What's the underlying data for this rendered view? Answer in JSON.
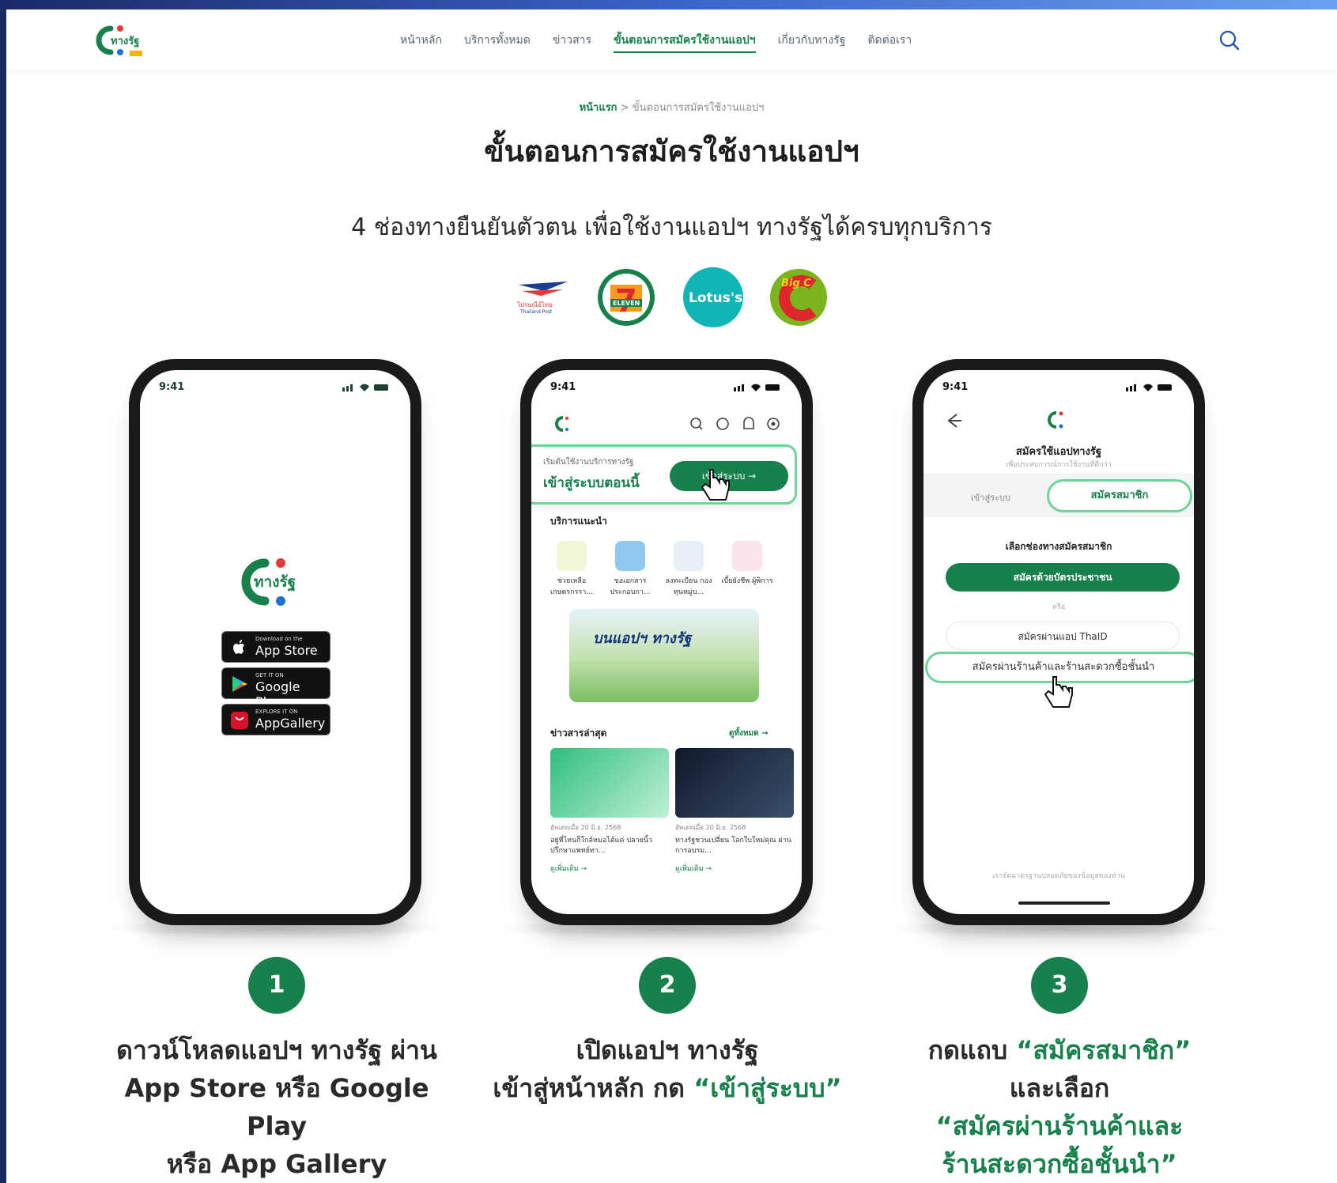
{
  "header": {
    "nav": [
      "หน้าหลัก",
      "บริการทั้งหมด",
      "ข่าวสาร",
      "ขั้นตอนการสมัครใช้งานแอปฯ",
      "เกี่ยวกับทางรัฐ",
      "ติดต่อเรา"
    ],
    "active_index": 3
  },
  "breadcrumb": {
    "home": "หน้าแรก",
    "sep": " > ",
    "current": "ขั้นตอนการสมัครใช้งานแอปฯ"
  },
  "title": "ขั้นตอนการสมัครใช้งานแอปฯ",
  "subtitle": "4 ช่องทางยืนยันตัวตน เพื่อใช้งานแอปฯ ทางรัฐได้ครบทุกบริการ",
  "partners": {
    "lotus": "Lotus's",
    "bigc": "Big C",
    "seven": "ELEVEN"
  },
  "phone1": {
    "time": "9:41",
    "app_name": "ทางรัฐ",
    "stores": [
      {
        "small": "Download on the",
        "big": "App Store"
      },
      {
        "small": "GET IT ON",
        "big": "Google Play"
      },
      {
        "small": "EXPLORE IT ON",
        "big": "AppGallery"
      }
    ]
  },
  "phone2": {
    "time": "9:41",
    "card_line1": "เริ่มต้นใช้งานบริการทางรัฐ",
    "card_line2": "เข้าสู่ระบบตอนนี้",
    "login_btn": "เข้าสู่ระบบ →",
    "recommended": "บริการแนะนำ",
    "services": [
      "ช่วยเหลือ เกษตรกรรา...",
      "ขอเอกสาร ประกอบกา...",
      "ลงทะเบียน กองทุนหมู่บ...",
      "เบี้ยยังชีพ ผู้พิการ"
    ],
    "banner": "บนแอปฯ ทางรัฐ",
    "news_label": "ข่าวสารล่าสุด",
    "see_all": "ดูทั้งหมด →",
    "news": [
      {
        "date": "อัพเดทเมื่อ 20 มิ.ย. 2568",
        "title": "อยู่ที่ไหนก็ใกล้หมอได้แค่ ปลายนิ้ว ปรึกษาแพทย์ทา...",
        "more": "ดูเพิ่มเติม →"
      },
      {
        "date": "อัพเดทเมื่อ 20 มิ.ย. 2568",
        "title": "ทางรัฐชวนเปลี่ยน โลกใบใหม่คุณ ผ่านการอบรม...",
        "more": "ดูเพิ่มเติม →"
      }
    ]
  },
  "phone3": {
    "time": "9:41",
    "reg_title": "สมัครใช้แอปทางรัฐ",
    "reg_sub": "เพื่อประสบการณ์การใช้งานที่ดีกว่า",
    "tab_login": "เข้าสู่ระบบ",
    "tab_member": "สมัครสมาชิก",
    "choose": "เลือกช่องทางสมัครสมาชิก",
    "id_btn": "สมัครด้วยบัตรประชาชน",
    "or": "หรือ",
    "thaid_btn": "สมัครผ่านแอป ThaID",
    "store_btn": "สมัครผ่านร้านค้าและร้านสะดวกซื้อชั้นนำ",
    "foot": "เราจัดมาตรฐานปลอดภัยของข้อมูลของท่าน"
  },
  "steps": [
    {
      "num": "1",
      "line1": "ดาวน์โหลดแอปฯ ทางรัฐ ผ่าน",
      "line2": "App Store หรือ Google Play",
      "line3": "หรือ App Gallery"
    },
    {
      "num": "2",
      "line1": "เปิดแอปฯ ทางรัฐ",
      "line2_pre": "เข้าสู่หน้าหลัก กด ",
      "line2_hl": "“เข้าสู่ระบบ”"
    },
    {
      "num": "3",
      "line1_pre": "กดแถบ ",
      "line1_hl": "“สมัครสมาชิก”",
      "line2": "และเลือก",
      "line3_hl": "“สมัครผ่านร้านค้าและ",
      "line4_hl": "ร้านสะดวกซื้อชั้นนำ”"
    }
  ],
  "colors": {
    "brand_green": "#17804b",
    "highlight_border": "#6fd49a",
    "lotus_teal": "#12b5b5",
    "bigc_green": "#7ab51d",
    "seven_red": "#e0262d"
  }
}
